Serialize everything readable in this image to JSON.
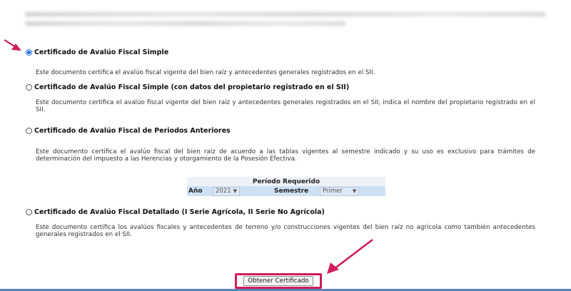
{
  "options": [
    {
      "label": "Certificado de Avalúo Fiscal Simple",
      "checked": true,
      "description": "Este documento certifica el avalúo fiscal vigente del bien raíz y antecedentes generales registrados en el SII."
    },
    {
      "label": "Certificado de Avalúo Fiscal Simple (con datos del propietario registrado en el SII)",
      "checked": false,
      "description": "Este documento certifica el avalúo fiscal vigente del bien raíz y antecedentes generales registrados en el SII, indica el nombre del propietario registrado en el SII."
    },
    {
      "label": "Certificado de Avalúo Fiscal de Periodos Anteriores",
      "checked": false,
      "description": "Este documento certifica el avalúo fiscal del bien raíz de acuerdo a las tablas vigentes al semestre indicado y su uso es exclusivo para trámites de determinación del impuesto a las Herencias y otorgamiento de la Posesión Efectiva."
    },
    {
      "label": "Certificado de Avalúo Fiscal Detallado (I Serie Agrícola, II Serie No Agrícola)",
      "checked": false,
      "description": "Este documento certifica los avalúos fiscales y antecedentes de terreno y/o construcciones vigentes del bien raíz no agrícola como también antecedentes generales registrados en el SII."
    }
  ],
  "period": {
    "title": "Período Requerido",
    "year_label": "Año",
    "year_value": "2021",
    "semester_label": "Semestre",
    "semester_value": "Primer"
  },
  "submit_label": "Obtener Certificado",
  "colors": {
    "annotation": "#d01c5c",
    "radio_accent": "#1a6ed8",
    "period_row": "#cfe0f4",
    "footer_bar": "#5a85b7"
  }
}
